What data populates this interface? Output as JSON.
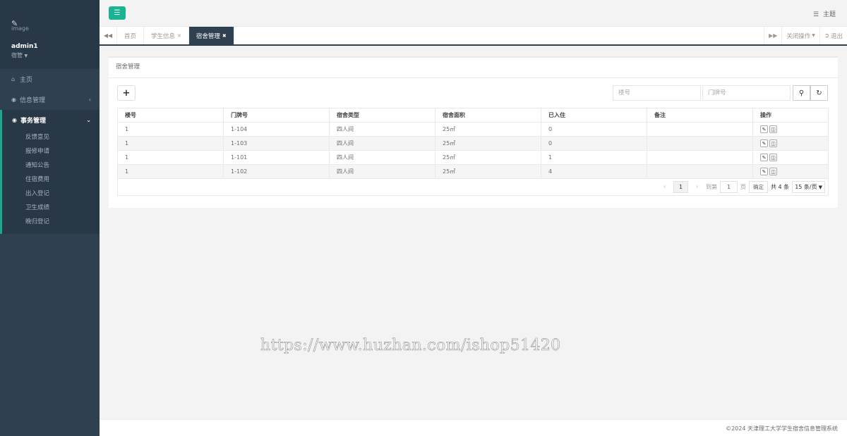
{
  "sidebar": {
    "logo_alt": "image",
    "user": "admin1",
    "role": "宿管",
    "nav": [
      {
        "label": "主页",
        "icon": "home-icon"
      },
      {
        "label": "信息管理",
        "icon": "circle-icon"
      }
    ],
    "group": {
      "label": "事务管理",
      "icon": "circle-icon",
      "items": [
        "反馈意见",
        "报修申请",
        "通知公告",
        "住宿费用",
        "出入登记",
        "卫生成绩",
        "晚归登记"
      ]
    }
  },
  "topbar": {
    "theme_label": "主题"
  },
  "tabs": [
    {
      "label": "首页"
    },
    {
      "label": "学生信息"
    },
    {
      "label": "宿舍管理"
    }
  ],
  "tab_controls": {
    "close_ops": "关闭操作",
    "logout": "退出"
  },
  "panel": {
    "title": "宿舍管理",
    "search": {
      "building_placeholder": "楼号",
      "door_placeholder": "门牌号"
    },
    "columns": [
      "楼号",
      "门牌号",
      "宿舍类型",
      "宿舍面积",
      "已入住",
      "备注",
      "操作"
    ],
    "rows": [
      [
        "1",
        "1-104",
        "四人间",
        "25㎡",
        "0",
        ""
      ],
      [
        "1",
        "1-103",
        "四人间",
        "25㎡",
        "0",
        ""
      ],
      [
        "1",
        "1-101",
        "四人间",
        "25㎡",
        "1",
        ""
      ],
      [
        "1",
        "1-102",
        "四人间",
        "25㎡",
        "4",
        ""
      ]
    ],
    "pager": {
      "current": "1",
      "goto_label": "到第",
      "goto_value": "1",
      "page_unit": "页",
      "confirm": "确定",
      "total": "共 4 条",
      "page_size": "15 条/页"
    }
  },
  "watermark": "https://www.huzhan.com/ishop51420",
  "footer": {
    "copyright": "©2024 天津理工大学学生宿舍信息管理系统"
  }
}
